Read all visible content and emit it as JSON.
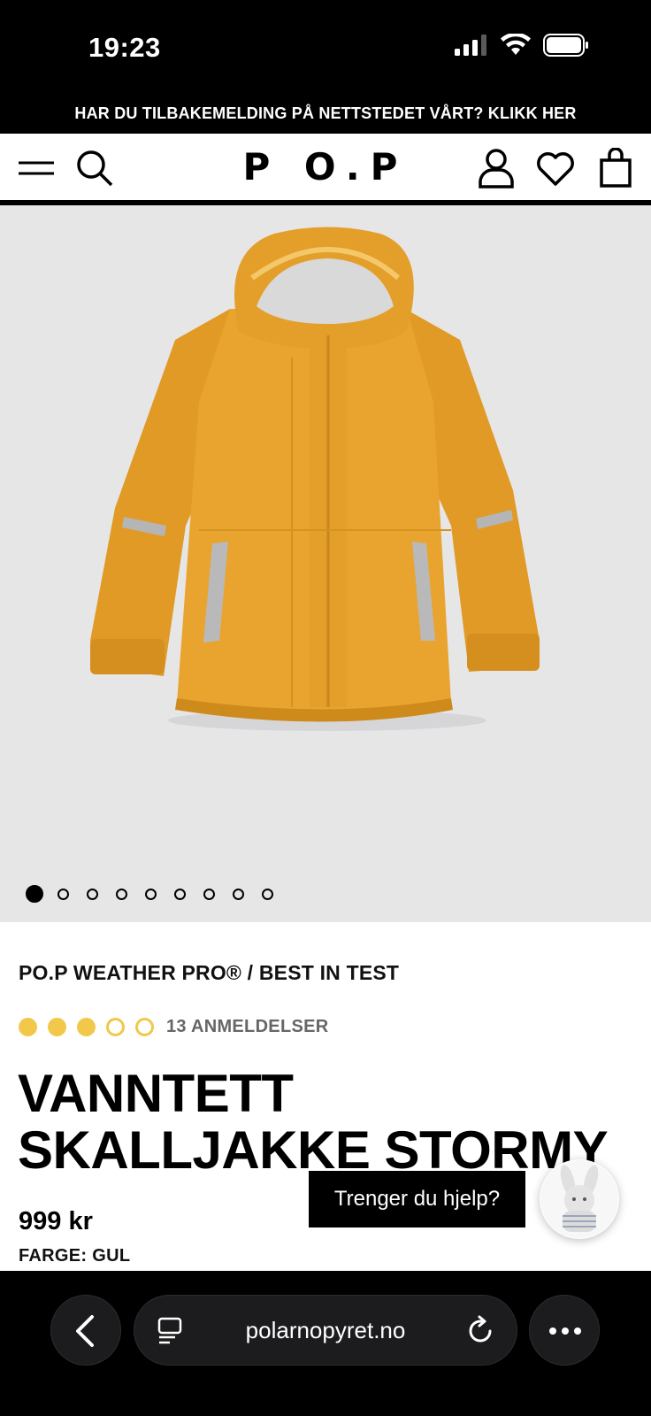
{
  "status_bar": {
    "time": "19:23"
  },
  "announcement": {
    "text": "HAR DU TILBAKEMELDING PÅ NETTSTEDET VÅRT? KLIKK HER"
  },
  "header": {
    "logo": "P O.P"
  },
  "carousel": {
    "total_images": 9,
    "active_index": 0
  },
  "product": {
    "brand_line": "PO.P WEATHER PRO® / BEST IN TEST",
    "rating": {
      "filled": 3,
      "total": 5,
      "color": "#f2c84b"
    },
    "reviews": "13 ANMELDELSER",
    "title": "VANNTETT SKALLJAKKE STORMY",
    "price": "999 kr",
    "color_label": "FARGE: GUL"
  },
  "help": {
    "label": "Trenger du hjelp?"
  },
  "browser": {
    "url": "polarnopyret.no"
  },
  "colors": {
    "jacket": "#e5a029",
    "background": "#e6e6e7",
    "accent_star": "#f2c84b"
  }
}
